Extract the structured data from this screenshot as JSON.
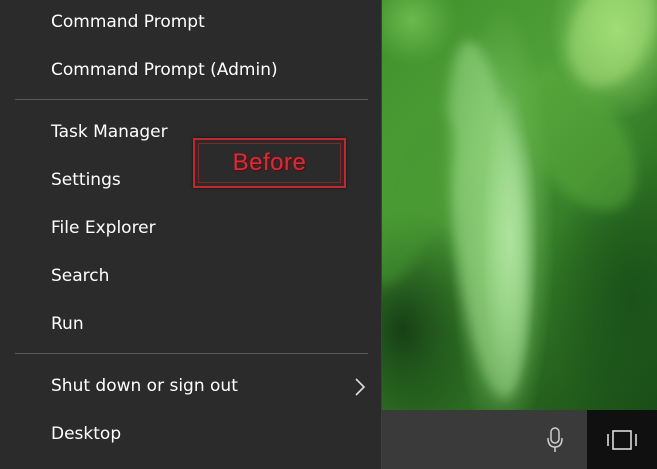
{
  "menu": {
    "items": [
      {
        "label": "Command Prompt"
      },
      {
        "label": "Command Prompt (Admin)"
      },
      {
        "label": "Task Manager"
      },
      {
        "label": "Settings"
      },
      {
        "label": "File Explorer"
      },
      {
        "label": "Search"
      },
      {
        "label": "Run"
      },
      {
        "label": "Shut down or sign out"
      },
      {
        "label": "Desktop"
      }
    ]
  },
  "annotation": {
    "text": "Before",
    "color": "#c4262e"
  },
  "taskbar": {
    "icons": [
      "microphone-icon",
      "task-view-icon"
    ]
  },
  "colors": {
    "menu_background": "#2b2b2b",
    "menu_text": "#ffffff",
    "taskbar_background": "#101010",
    "search_box_background": "#3a3a3a"
  }
}
